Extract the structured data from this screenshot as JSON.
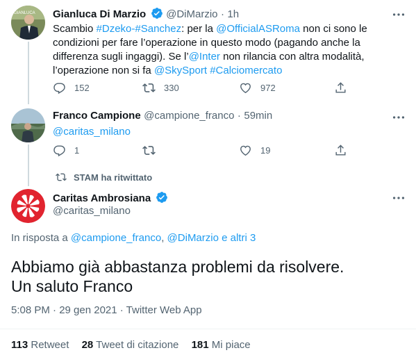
{
  "tweet1": {
    "name": "Gianluca Di Marzio",
    "handle": "@DiMarzio",
    "sep": "·",
    "time": "1h",
    "text_lines": [
      [
        {
          "t": "Scambio "
        },
        {
          "t": "#Dzeko-#Sanchez",
          "link": true
        },
        {
          "t": ": per la "
        },
        {
          "t": "@OfficialASRoma",
          "link": true
        },
        {
          "t": " non ci sono le"
        }
      ],
      [
        {
          "t": "condizioni per fare l’operazione in questo modo (pagando anche la"
        }
      ],
      [
        {
          "t": "differenza sugli ingaggi). Se l’"
        },
        {
          "t": "@Inter",
          "link": true
        },
        {
          "t": " non rilancia con altra modalità,"
        }
      ],
      [
        {
          "t": "l’operazione non si fa "
        },
        {
          "t": "@SkySport",
          "link": true
        },
        {
          "t": " "
        },
        {
          "t": "#Calciomercato",
          "link": true
        }
      ]
    ],
    "replies": "152",
    "retweets": "330",
    "likes": "972"
  },
  "tweet2": {
    "name": "Franco Campione",
    "handle": "@campione_franco",
    "sep": "·",
    "time": "59min",
    "text": "@caritas_milano",
    "replies": "1",
    "retweets": "",
    "likes": "19"
  },
  "retweet_banner": "STAM ha ritwittato",
  "main": {
    "name": "Caritas Ambrosiana",
    "handle": "@caritas_milano",
    "reply_prefix": "In risposta a ",
    "reply_user1": "@campione_franco",
    "reply_comma": ", ",
    "reply_user2": "@DiMarzio",
    "reply_others": " e altri 3",
    "text_line1": "Abbiamo già abbastanza problemi da risolvere.",
    "text_line2": "Un saluto Franco",
    "timestamp": "5:08 PM · 29 gen 2021 · Twitter Web App",
    "retweet_count": "113",
    "retweet_label": "Retweet",
    "quote_count": "28",
    "quote_label": "Tweet di citazione",
    "like_count": "181",
    "like_label": "Mi piace"
  },
  "colors": {
    "accent": "#1d9bf0",
    "text": "#0f1419",
    "secondary": "#536471",
    "caritas_red": "#e1242f"
  },
  "icons": [
    "verified-icon",
    "more-icon",
    "reply-icon",
    "retweet-icon",
    "like-icon",
    "share-icon"
  ]
}
